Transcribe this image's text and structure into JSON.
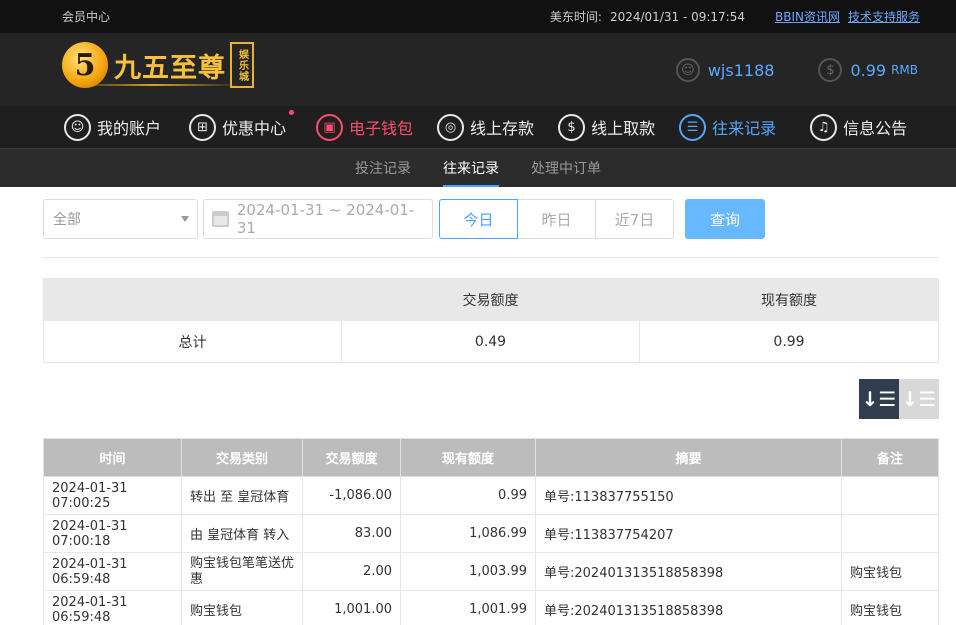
{
  "topbar": {
    "left": "会员中心",
    "time_label": "美东时间:",
    "time_value": "2024/01/31 - 09:17:54",
    "link1": "BBIN资讯网",
    "link2": "技术支持服务"
  },
  "brand": {
    "digit": "5",
    "name": "九五至尊",
    "badge": "娱乐城"
  },
  "user": {
    "username": "wjs1188",
    "balance": "0.99",
    "currency": "RMB"
  },
  "nav": [
    {
      "label": "我的账户",
      "icon": "user-icon"
    },
    {
      "label": "优惠中心",
      "icon": "gift-icon"
    },
    {
      "label": "电子钱包",
      "icon": "wallet-icon"
    },
    {
      "label": "线上存款",
      "icon": "deposit-icon"
    },
    {
      "label": "线上取款",
      "icon": "withdraw-icon"
    },
    {
      "label": "往来记录",
      "icon": "records-icon"
    },
    {
      "label": "信息公告",
      "icon": "bell-icon"
    }
  ],
  "subnav": [
    "投注记录",
    "往来记录",
    "处理中订单"
  ],
  "filters": {
    "type": "全部",
    "daterange": "2024-01-31 ~ 2024-01-31",
    "today": "今日",
    "yesterday": "昨日",
    "week": "近7日",
    "query": "查询"
  },
  "summary": {
    "h1": "交易额度",
    "h2": "现有额度",
    "label": "总计",
    "amount": "0.49",
    "balance": "0.99"
  },
  "records": {
    "headers": [
      "时间",
      "交易类别",
      "交易额度",
      "现有额度",
      "摘要",
      "备注"
    ],
    "rows": [
      [
        "2024-01-31 07:00:25",
        "转出 至 皇冠体育",
        "-1,086.00",
        "0.99",
        "单号:113837755150",
        ""
      ],
      [
        "2024-01-31 07:00:18",
        "由 皇冠体育 转入",
        "83.00",
        "1,086.99",
        "单号:113837754207",
        ""
      ],
      [
        "2024-01-31 06:59:48",
        "购宝钱包笔笔送优惠",
        "2.00",
        "1,003.99",
        "单号:20240131351885839​8",
        "购宝钱包"
      ],
      [
        "2024-01-31 06:59:48",
        "购宝钱包",
        "1,001.00",
        "1,001.99",
        "单号:202401313518858398",
        "购宝钱包"
      ]
    ]
  }
}
